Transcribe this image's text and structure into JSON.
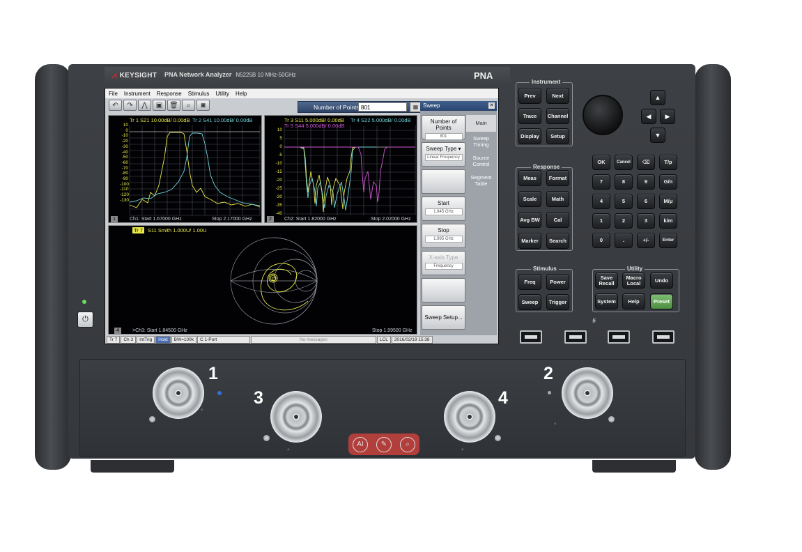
{
  "header": {
    "brand": "KEYSIGHT",
    "product": "PNA Network Analyzer",
    "model": "N5225B  10 MHz-50GHz",
    "family": "PNA"
  },
  "menu": [
    "File",
    "Instrument",
    "Response",
    "Stimulus",
    "Utility",
    "Help"
  ],
  "toolbar": {
    "icons": [
      "undo-icon",
      "redo-icon",
      "trace-icon",
      "marker-icon",
      "delete-icon",
      "zoom-icon",
      "camera-icon"
    ],
    "points_label": "Number of Points",
    "points_value": "801"
  },
  "windows": [
    {
      "num": "1",
      "traces": [
        "Tr 1   S21 10.00dB/ 0.00dB",
        "Tr 2   S41 10.00dB/ 0.00dB"
      ],
      "start": "Ch1:  Start  1.67000 GHz",
      "stop": "Stop  2.17000 GHz",
      "yticks": [
        "10",
        "0",
        "-10",
        "-20",
        "-30",
        "-40",
        "-50",
        "-60",
        "-70",
        "-80",
        "-90",
        "-100",
        "-110",
        "-120",
        "-130"
      ]
    },
    {
      "num": "2",
      "traces": [
        "Tr 3   S11 5.000dB/ 0.00dB",
        "Tr 4   S22 5.000dB/ 0.00dB",
        "Tr 5   S44 5.000dB/ 0.00dB"
      ],
      "start": "Ch2:  Start  1.82000 GHz",
      "stop": "Stop  2.02000 GHz",
      "yticks": [
        "10",
        "5",
        "0",
        "-5",
        "-10",
        "-15",
        "-20",
        "-25",
        "-30",
        "-35",
        "-40"
      ]
    },
    {
      "num": "4",
      "traces": [
        "Tr 7",
        "S11 Smith 1.000U/ 1.00U"
      ],
      "start": ">Ch3:  Start   1.84500 GHz",
      "stop": "Stop  1.99500 GHz"
    }
  ],
  "softkeys": {
    "title": "Sweep",
    "keys": [
      {
        "label": "Number of Points",
        "value": "801"
      },
      {
        "label": "Sweep Type",
        "value": "Linear Frequency"
      },
      {
        "label": "",
        "value": ""
      },
      {
        "label": "Start",
        "value": "1.845 GHz"
      },
      {
        "label": "Stop",
        "value": "1.995 GHz"
      },
      {
        "label": "X-axis Type",
        "value": "Frequency"
      },
      {
        "label": "",
        "value": ""
      },
      {
        "label": "Sweep Setup...",
        "value": ""
      }
    ],
    "tabs": [
      "Main",
      "Sweep Timing",
      "Source Control",
      "Segment Table"
    ]
  },
  "statusbar": [
    "Tr 7",
    "Ch 3",
    "IntTrig",
    "Hold",
    "BW=100k",
    "C  1-Port",
    "No messages",
    "LCL",
    "2016/02/19 15:38"
  ],
  "panel": {
    "instrument": {
      "label": "Instrument",
      "keys": [
        "Prev",
        "Next",
        "Trace",
        "Channel",
        "Display",
        "Setup"
      ]
    },
    "response": {
      "label": "Response",
      "keys": [
        "Meas",
        "Format",
        "Scale",
        "Math",
        "Avg BW",
        "Cal",
        "Marker",
        "Search"
      ]
    },
    "stimulus": {
      "label": "Stimulus",
      "keys": [
        "Freq",
        "Power",
        "Sweep",
        "Trigger"
      ]
    },
    "utility": {
      "label": "Utility",
      "keys": [
        "Save Recall",
        "Macro Local",
        "Undo",
        "System",
        "Help",
        "Preset"
      ]
    },
    "numpad": [
      "OK",
      "Cancel",
      "⌫",
      "T/p",
      "7",
      "8",
      "9",
      "G/n",
      "4",
      "5",
      "6",
      "M/μ",
      "1",
      "2",
      "3",
      "k/m",
      "0",
      ".",
      "+/-",
      "Enter"
    ]
  },
  "ports": [
    "1",
    "2",
    "3",
    "4"
  ],
  "colors": {
    "yellow": "#e8e84a",
    "cyan": "#6fd3d8",
    "magenta": "#d155d4",
    "blue_ui": "#2e4a74"
  }
}
